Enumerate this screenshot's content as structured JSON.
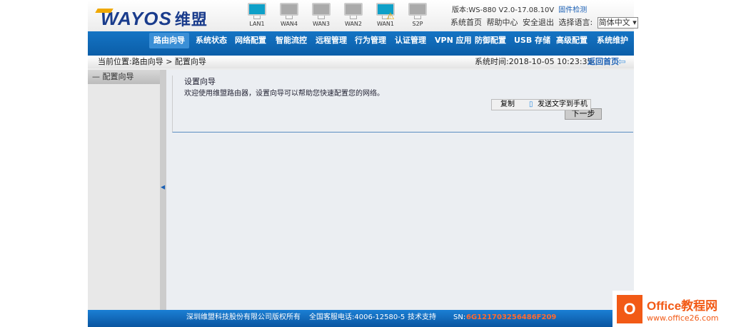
{
  "header": {
    "logo": "WAYOS",
    "logo_cn": "维盟",
    "ports": [
      {
        "label": "LAN1",
        "active": true,
        "warn": false
      },
      {
        "label": "WAN4",
        "active": false,
        "warn": false
      },
      {
        "label": "WAN3",
        "active": false,
        "warn": false
      },
      {
        "label": "WAN2",
        "active": false,
        "warn": false
      },
      {
        "label": "WAN1",
        "active": true,
        "warn": true
      },
      {
        "label": "S2P",
        "active": false,
        "warn": false
      }
    ],
    "version": "版本:WS-880 V2.0-17.08.10V",
    "firmware_link": "固件检测",
    "links": [
      "系统首页",
      "帮助中心",
      "安全退出"
    ],
    "lang_label": "选择语言:",
    "lang_value": "简体中文"
  },
  "nav": [
    "路由向导",
    "系统状态",
    "网络配置",
    "智能流控",
    "远程管理",
    "行为管理",
    "认证管理",
    "VPN 应用",
    "防御配置",
    "USB 存储",
    "高级配置",
    "系统维护"
  ],
  "breadcrumb": {
    "text": "当前位置:路由向导 > 配置向导",
    "time": "系统时间:2018-10-05 10:23:35",
    "home": "返回首页"
  },
  "sidebar": {
    "item": "配置向导"
  },
  "main": {
    "title": "设置向导",
    "desc": "欢迎使用维盟路由器，设置向导可以帮助您快速配置您的网络。",
    "next": "下一步",
    "popup": {
      "copy": "复制",
      "send": "发送文字到手机"
    }
  },
  "footer": {
    "copyright": "深圳维盟科技股份有限公司版权所有",
    "phone": "全国客服电话:4006-12580-5",
    "support": "技术支持",
    "sn_label": "SN:",
    "sn": "6G121703256486F209"
  },
  "watermark": {
    "title": "Office教程网",
    "url": "www.office26.com"
  }
}
